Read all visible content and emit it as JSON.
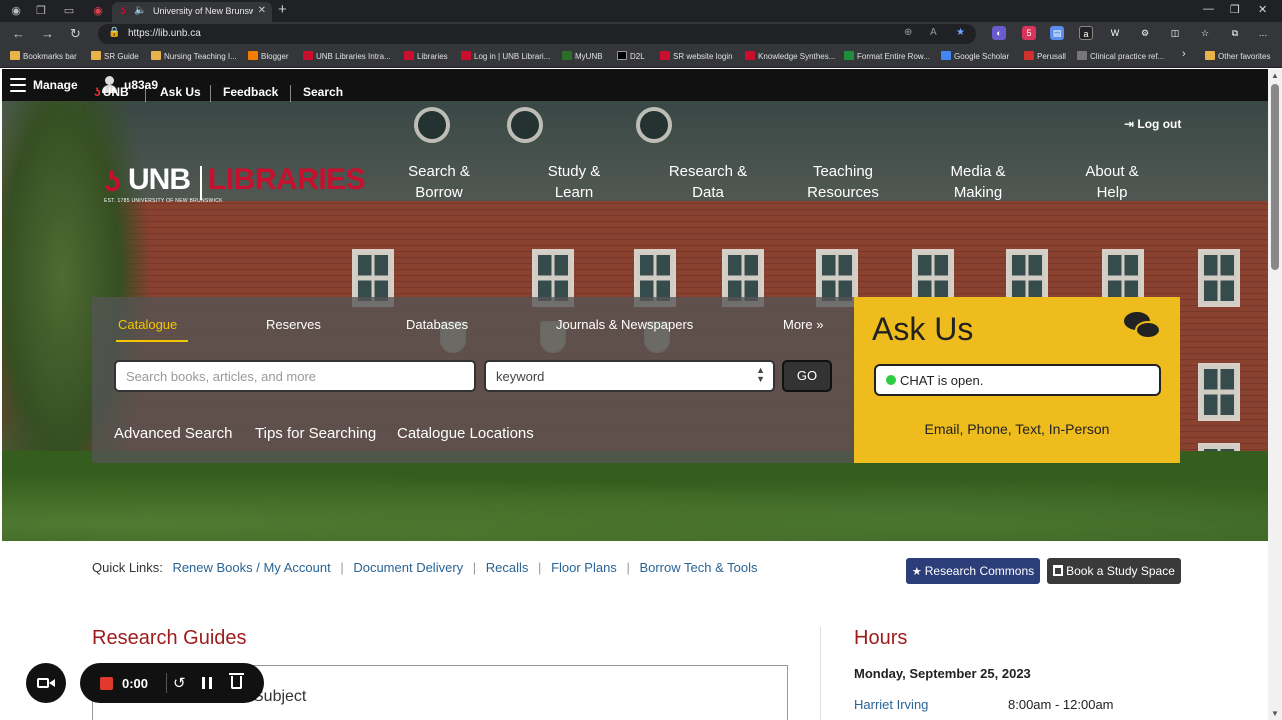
{
  "browser": {
    "tab_title": "University of New Brunswick",
    "url": "https://lib.unb.ca",
    "new_tab": "+",
    "bookmarks": [
      {
        "label": "Bookmarks bar",
        "icon": "folder-icon"
      },
      {
        "label": "SR Guide",
        "icon": "folder-icon"
      },
      {
        "label": "Nursing Teaching I...",
        "icon": "folder-icon"
      },
      {
        "label": "Blogger",
        "icon": "blogger-icon"
      },
      {
        "label": "UNB Libraries Intra...",
        "icon": "unb-icon"
      },
      {
        "label": "Libraries",
        "icon": "unb-icon"
      },
      {
        "label": "Log in | UNB Librari...",
        "icon": "unb-icon"
      },
      {
        "label": "MyUNB",
        "icon": "myunb-icon"
      },
      {
        "label": "D2L",
        "icon": "d2l-icon"
      },
      {
        "label": "SR website login",
        "icon": "unb-icon"
      },
      {
        "label": "Knowledge Synthes...",
        "icon": "unb-icon"
      },
      {
        "label": "Format Entire Row...",
        "icon": "sheet-icon"
      },
      {
        "label": "Google Scholar",
        "icon": "scholar-icon"
      },
      {
        "label": "Perusall",
        "icon": "perusall-icon"
      },
      {
        "label": "Clinical practice ref...",
        "icon": "link-icon"
      }
    ],
    "bookmarks_more": "›",
    "other_favorites": "Other favorites"
  },
  "manage_bar": {
    "manage_label": "Manage",
    "username": "u83a9"
  },
  "top_links": {
    "unb": "UNB",
    "ask_us": "Ask Us",
    "feedback": "Feedback",
    "search": "Search",
    "logout": "Log out"
  },
  "logo": {
    "unb": "UNB",
    "libraries": "LIBRARIES",
    "subtitle": "EST. 1785 UNIVERSITY OF NEW BRUNSWICK"
  },
  "main_nav": [
    {
      "line1": "Search &",
      "line2": "Borrow"
    },
    {
      "line1": "Study &",
      "line2": "Learn"
    },
    {
      "line1": "Research &",
      "line2": "Data"
    },
    {
      "line1": "Teaching",
      "line2": "Resources"
    },
    {
      "line1": "Media &",
      "line2": "Making"
    },
    {
      "line1": "About &",
      "line2": "Help"
    }
  ],
  "search_panel": {
    "tabs": [
      "Catalogue",
      "Reserves",
      "Databases",
      "Journals & Newspapers"
    ],
    "more": "More »",
    "placeholder": "Search books, articles, and more",
    "search_type": "keyword",
    "go": "GO",
    "links": [
      "Advanced Search",
      "Tips for Searching",
      "Catalogue Locations"
    ]
  },
  "ask_us": {
    "title": "Ask Us",
    "chat_status": "CHAT is open.",
    "methods": "Email, Phone, Text, In-Person"
  },
  "quick_links": {
    "label": "Quick Links:",
    "links": [
      "Renew Books / My Account",
      "Document Delivery",
      "Recalls",
      "Floor Plans",
      "Borrow Tech & Tools"
    ],
    "research_commons": "Research Commons",
    "book_study_space": "Book a Study Space"
  },
  "research_guides": {
    "title": "Research Guides",
    "box_text": "Subject"
  },
  "hours": {
    "title": "Hours",
    "date": "Monday, September 25, 2023",
    "library": "Harriet Irving",
    "time": "8:00am - 12:00am"
  },
  "recorder": {
    "time": "0:00"
  },
  "colors": {
    "unb_red": "#c8102e",
    "ask_yellow": "#eebc1d",
    "catalogue_active": "#f4c600",
    "link_blue": "#2a6496",
    "heading_red": "#9e1b1b",
    "research_commons_btn": "#2c3e7a"
  }
}
